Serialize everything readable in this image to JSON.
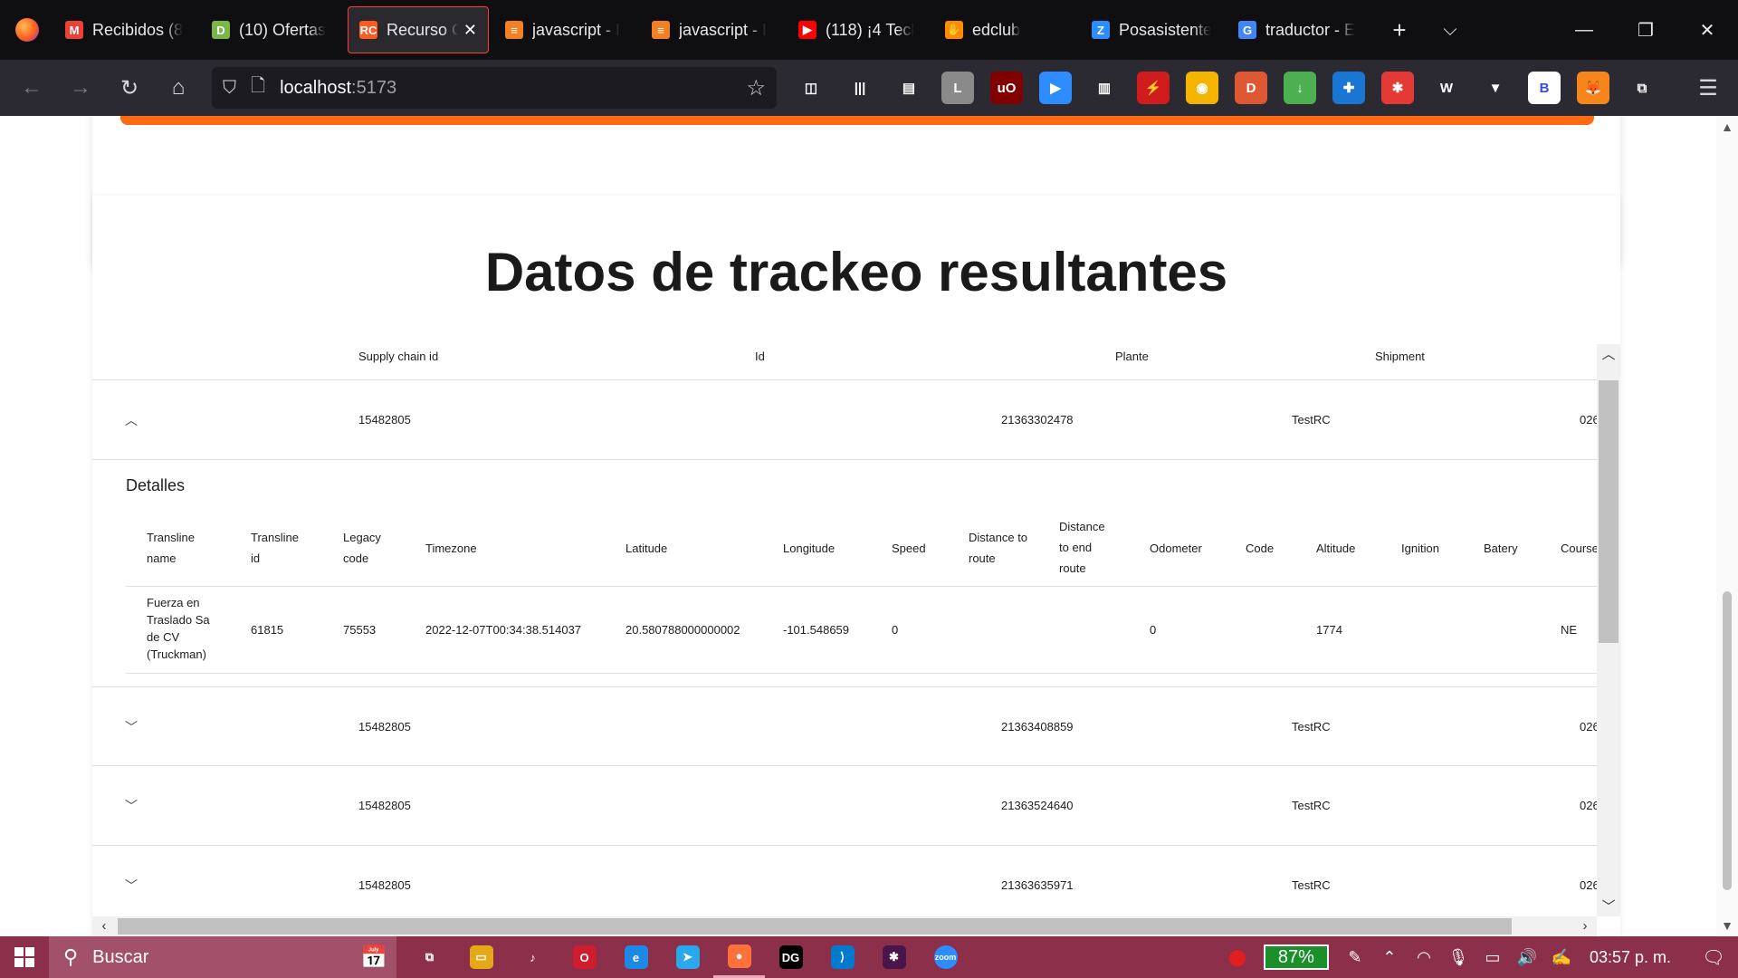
{
  "browser": {
    "tabs": [
      {
        "title": "Recibidos (8",
        "favicon": "M",
        "favicon_color": "#ea4335",
        "icon_name": "gmail-icon",
        "active": false
      },
      {
        "title": "(10) Ofertas",
        "favicon": "D",
        "favicon_color": "#7ab648",
        "icon_name": "d-icon",
        "active": false
      },
      {
        "title": "Recurso C",
        "favicon": "RC",
        "favicon_color": "#ff5a1f",
        "icon_name": "rc-icon",
        "active": true
      },
      {
        "title": "javascript - I",
        "favicon": "≡",
        "favicon_color": "#f48024",
        "icon_name": "stackoverflow-icon",
        "active": false
      },
      {
        "title": "javascript - I",
        "favicon": "≡",
        "favicon_color": "#f48024",
        "icon_name": "stackoverflow-icon",
        "active": false
      },
      {
        "title": "(118) ¡4 Tecl",
        "favicon": "▶",
        "favicon_color": "#ff0000",
        "icon_name": "youtube-icon",
        "active": false
      },
      {
        "title": "edclub",
        "favicon": "✋",
        "favicon_color": "#ff8c00",
        "icon_name": "edclub-icon",
        "active": false
      },
      {
        "title": "Posasistente",
        "favicon": "Z",
        "favicon_color": "#2d8cff",
        "icon_name": "zoom-icon",
        "active": false
      },
      {
        "title": "traductor - E",
        "favicon": "G",
        "favicon_color": "#4285f4",
        "icon_name": "google-icon",
        "active": false
      }
    ],
    "url_host": "localhost",
    "url_port": ":5173",
    "extensions": [
      {
        "label": "◫",
        "color": "#2b2a33",
        "name": "pocket-icon"
      },
      {
        "label": "|||",
        "color": "#2b2a33",
        "name": "library-icon"
      },
      {
        "label": "▤",
        "color": "#2b2a33",
        "name": "reader-view-icon"
      },
      {
        "label": "L",
        "color": "#8a8a8a",
        "name": "l-extension-icon"
      },
      {
        "label": "uO",
        "color": "#800000",
        "name": "ublock-icon"
      },
      {
        "label": "▶",
        "color": "#2d8cff",
        "name": "zoom-extension-icon"
      },
      {
        "label": "▥",
        "color": "#2b2a33",
        "name": "ruler-extension-icon"
      },
      {
        "label": "⚡",
        "color": "#d01c1c",
        "name": "red-extension-icon"
      },
      {
        "label": "◉",
        "color": "#f5b400",
        "name": "medal-extension-icon"
      },
      {
        "label": "D",
        "color": "#de5833",
        "name": "duckduckgo-icon"
      },
      {
        "label": "↓",
        "color": "#4caf50",
        "name": "download-extension-icon"
      },
      {
        "label": "✚",
        "color": "#1976d2",
        "name": "blue-extension-icon"
      },
      {
        "label": "✱",
        "color": "#e53935",
        "name": "red-cross-extension-icon"
      },
      {
        "label": "W",
        "color": "#2b2a33",
        "name": "w-extension-icon"
      },
      {
        "label": "▼",
        "color": "#2b2a33",
        "name": "v-extension-icon"
      },
      {
        "label": "B",
        "color": "#ffffff",
        "name": "b-extension-icon"
      },
      {
        "label": "🦊",
        "color": "#f6851b",
        "name": "metamask-icon"
      },
      {
        "label": "⧉",
        "color": "#2b2a33",
        "name": "cast-icon"
      }
    ]
  },
  "page": {
    "title": "Datos de trackeo resultantes",
    "table": {
      "columns": [
        "Supply chain id",
        "Id",
        "Plante",
        "Shipment"
      ],
      "rows": [
        {
          "supply_chain_id": "15482805",
          "id": "21363302478",
          "plante": "TestRC",
          "shipment": "026",
          "expanded": true
        },
        {
          "supply_chain_id": "15482805",
          "id": "21363408859",
          "plante": "TestRC",
          "shipment": "026",
          "expanded": false
        },
        {
          "supply_chain_id": "15482805",
          "id": "21363524640",
          "plante": "TestRC",
          "shipment": "026",
          "expanded": false
        },
        {
          "supply_chain_id": "15482805",
          "id": "21363635971",
          "plante": "TestRC",
          "shipment": "026",
          "expanded": false
        }
      ]
    },
    "details": {
      "title": "Detalles",
      "columns": [
        "Transline name",
        "Transline id",
        "Legacy code",
        "Timezone",
        "Latitude",
        "Longitude",
        "Speed",
        "Distance to route",
        "Distance to end route",
        "Odometer",
        "Code",
        "Altitude",
        "Ignition",
        "Batery",
        "Course"
      ],
      "row": {
        "transline_name": "Fuerza en Traslado Sa de CV (Truckman)",
        "transline_id": "61815",
        "legacy_code": "75553",
        "timezone": "2022-12-07T00:34:38.514037",
        "latitude": "20.580788000000002",
        "longitude": "-101.548659",
        "speed": "0",
        "distance_to_route": "",
        "distance_to_end_route": "",
        "odometer": "0",
        "code": "",
        "altitude": "1774",
        "ignition": "",
        "batery": "",
        "course": "NE"
      }
    }
  },
  "taskbar": {
    "search_placeholder": "Buscar",
    "battery": "87%",
    "clock": "03:57 p. m.",
    "apps": [
      {
        "label": "⧉",
        "color": "transparent",
        "name": "task-view-icon"
      },
      {
        "label": "▭",
        "color": "#e6a817",
        "name": "file-explorer-icon"
      },
      {
        "label": "♪",
        "color": "transparent",
        "name": "music-app-icon"
      },
      {
        "label": "O",
        "color": "#d01c2f",
        "name": "opera-icon"
      },
      {
        "label": "e",
        "color": "#1e88e5",
        "name": "edge-icon"
      },
      {
        "label": "➤",
        "color": "#29a9eb",
        "name": "telegram-icon"
      },
      {
        "label": "●",
        "color": "#ff7139",
        "name": "firefox-icon",
        "active": true
      },
      {
        "label": "DG",
        "color": "#000000",
        "name": "datagrip-icon"
      },
      {
        "label": "⟩",
        "color": "#007acc",
        "name": "vscode-icon"
      },
      {
        "label": "✱",
        "color": "#4a154b",
        "name": "slack-icon"
      },
      {
        "label": "zoom",
        "color": "#2d8cff",
        "name": "zoom-app-icon"
      }
    ]
  },
  "colors": {
    "accent_orange": "#ff6a13",
    "taskbar_bg": "#8c2f4a",
    "tabstrip_bg": "#0f0f11",
    "navbar_bg": "#2b2a33"
  }
}
